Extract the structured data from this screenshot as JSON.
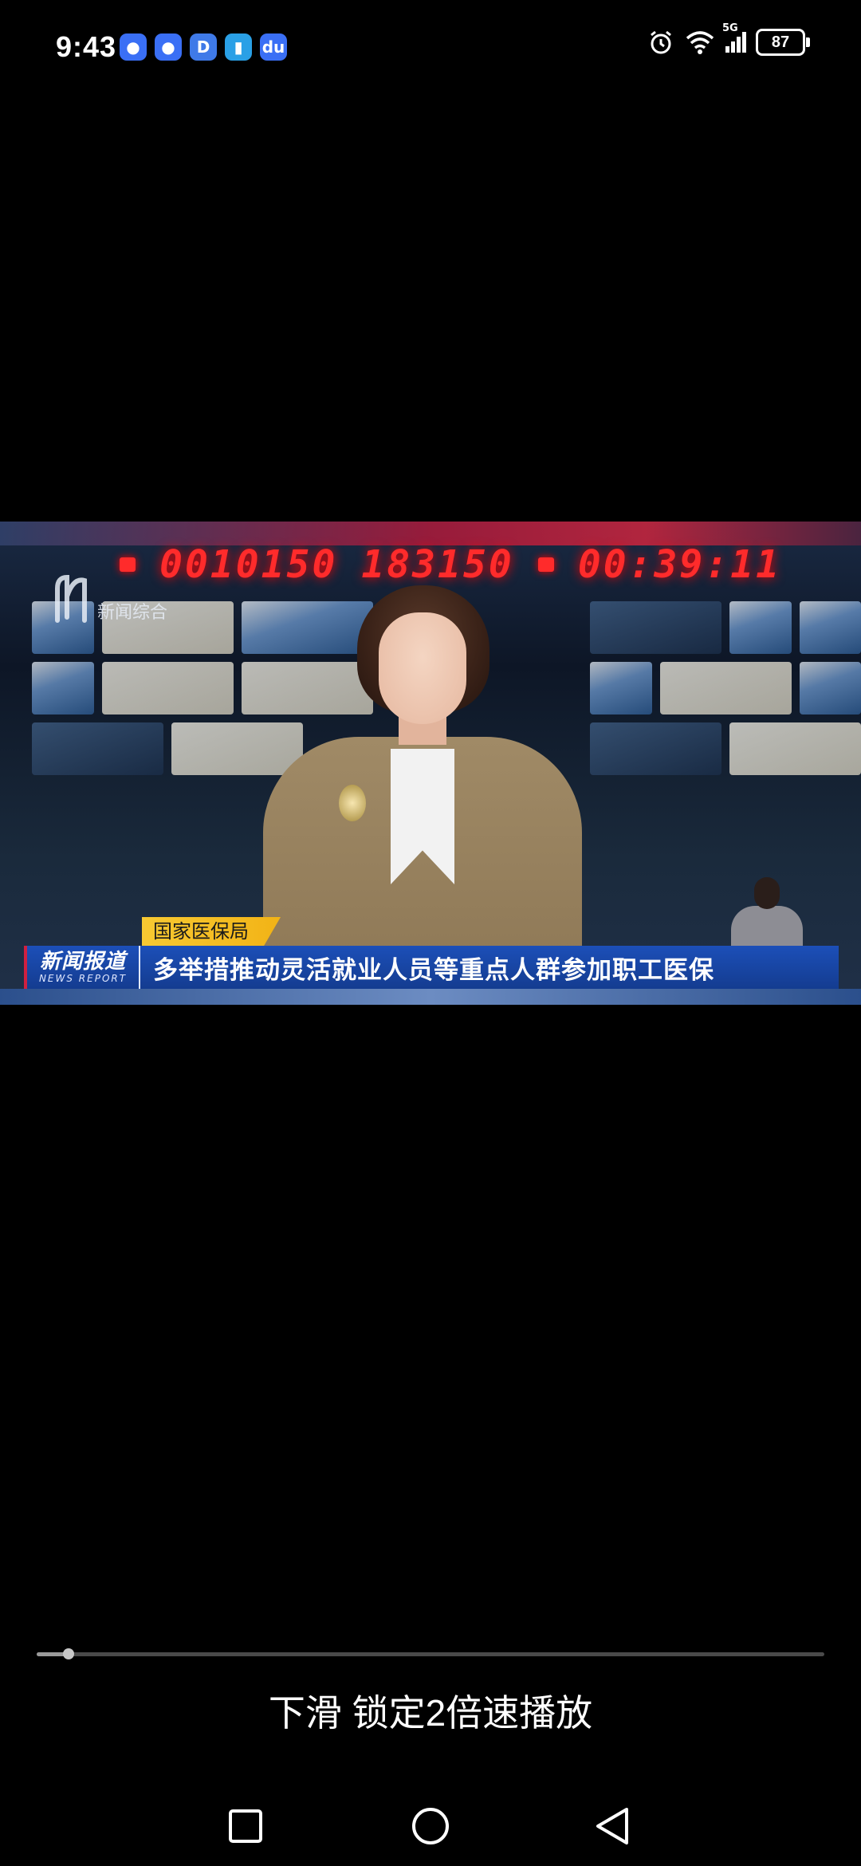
{
  "status_bar": {
    "time": "9:43",
    "battery": "87",
    "network": "5G",
    "app_icons": [
      {
        "name": "browser-icon",
        "glyph": "●",
        "color": "#3a6ff5"
      },
      {
        "name": "browser-icon",
        "glyph": "●",
        "color": "#3a6ff5"
      },
      {
        "name": "docs-icon",
        "glyph": "D",
        "color": "#3f7ae8"
      },
      {
        "name": "book-icon",
        "glyph": "▮",
        "color": "#2aa0e6"
      },
      {
        "name": "baidu-icon",
        "glyph": "du",
        "color": "#3a6ff5"
      }
    ]
  },
  "video": {
    "clocks": [
      "0010150",
      "183150",
      "00:39:11"
    ],
    "channel_logo": "新闻综合",
    "lower_third": {
      "tag": "国家医保局",
      "program_cn": "新闻报道",
      "program_en": "NEWS REPORT",
      "headline": "多举措推动灵活就业人员等重点人群参加职工医保"
    }
  },
  "playback": {
    "progress": 0.04,
    "hint": "下滑 锁定2倍速播放"
  },
  "navbar": {
    "recents": "recents-button",
    "home": "home-button",
    "back": "back-button"
  }
}
